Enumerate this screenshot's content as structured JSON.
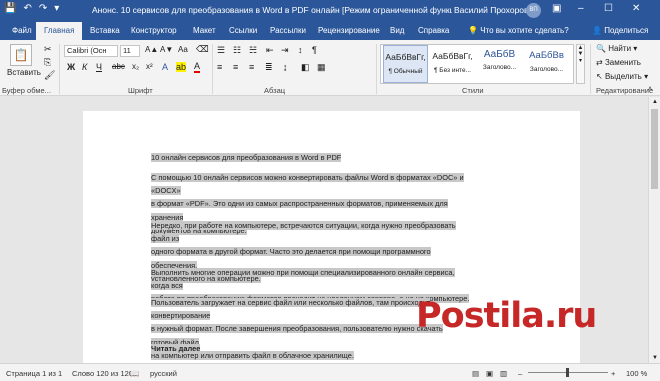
{
  "titlebar": {
    "title": "Анонс. 10 сервисов для преобразования в Word в PDF онлайн [Режим ограниченной функционал…",
    "user": "Василий Прохоров",
    "avatar": "ВП",
    "min": "–",
    "max": "☐",
    "close": "✕",
    "qat_save": "💾",
    "qat_undo": "↶",
    "qat_redo": "↷",
    "qat_more": "▾"
  },
  "tabs": [
    "Файл",
    "Главная",
    "Вставка",
    "Конструктор",
    "Макет",
    "Ссылки",
    "Рассылки",
    "Рецензирование",
    "Вид",
    "Справка"
  ],
  "tell_me": "Что вы хотите сделать?",
  "tell_me_icon": "lightbulb-icon",
  "share": "Поделиться",
  "ribbon": {
    "clipboard": {
      "paste": "Вставить",
      "label": "Буфер обме..."
    },
    "font": {
      "name": "Calibri (Осн",
      "size": "11",
      "bold": "Ж",
      "italic": "К",
      "underline": "Ч",
      "label": "Шрифт",
      "grow": "A▲",
      "shrink": "A▼",
      "clear": "Aa",
      "color": "A"
    },
    "paragraph": {
      "label": "Абзац",
      "sort": "↕",
      "marks": "¶"
    },
    "styles": {
      "label": "Стили",
      "items": [
        {
          "sample": "АаБбВвГг,",
          "name": "¶ Обычный"
        },
        {
          "sample": "АаБбВвГг,",
          "name": "¶ Без инте..."
        },
        {
          "sample": "АаБбВ",
          "name": "Заголово..."
        },
        {
          "sample": "АаБбВв",
          "name": "Заголово..."
        }
      ]
    },
    "editing": {
      "find": "Найти",
      "replace": "Заменить",
      "select": "Выделить",
      "label": "Редактирование"
    }
  },
  "document": {
    "paragraphs": [
      [
        "10 онлайн сервисов для преобразования в Word в PDF"
      ],
      [
        "С помощью 10 онлайн сервисов можно конвертировать файлы Word в форматах «DOC» и «DOCX»",
        "в формат «PDF». Это одни из самых распространенных форматов, применяемых для хранения",
        "документов на компьютере."
      ],
      [
        "Нередко, при работе на компьютере, встречаются ситуации, когда нужно преобразовать файл из",
        "одного формата в другой формат. Часто это делается при помощи программного обеспечения,",
        "установленного на компьютере."
      ],
      [
        "Выполнить многие операции можно при помощи специализированного онлайн сервиса, когда вся",
        "работа по преобразованию форматов проходит на удаленном сервере, а не на компьютере."
      ],
      [
        "Пользователь загружает на сервис файл или несколько файлов, там происходит конвертирование",
        "в нужный формат. После завершения преобразования, пользователю нужно скачать готовый файл",
        "на компьютер или отправить файл в облачное хранилище."
      ],
      [
        "Читать далее"
      ]
    ]
  },
  "statusbar": {
    "page": "Страница 1 из 1",
    "words": "Слово 120 из 120",
    "lang": "русский",
    "zoom": "100 %",
    "zoom_minus": "–",
    "zoom_plus": "+"
  },
  "watermark": "Postila.ru",
  "colors": {
    "accent": "#2b579a",
    "selection": "#c8c8c8",
    "watermark": "#c62828"
  }
}
